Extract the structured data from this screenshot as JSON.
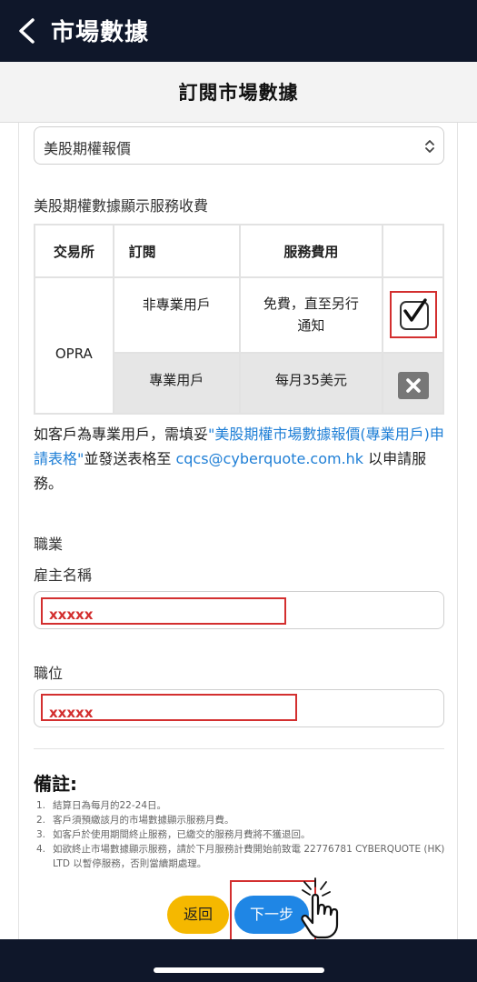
{
  "header": {
    "title": "市場數據"
  },
  "subheader": {
    "title": "訂閱市場數據"
  },
  "select": {
    "value": "美股期權報價"
  },
  "section": {
    "title": "美股期權數據顯示服務收費"
  },
  "table": {
    "headers": [
      "交易所",
      "訂閱",
      "服務費用",
      ""
    ],
    "exchange": "OPRA",
    "rows": [
      {
        "type": "非專業用戶",
        "fee": "免費，直至另行通知",
        "selected": true
      },
      {
        "type": "專業用戶",
        "fee": "每月35美元",
        "selected": false
      }
    ]
  },
  "notice": {
    "part1": "如客戶為專業用戶，需填妥",
    "link": "\"美股期權市場數據報價(專業用戶)申請表格\"",
    "part2": "並發送表格至 ",
    "email": "cqcs@cyberquote.com.hk",
    "part3": " 以申請服務。"
  },
  "form": {
    "occupation_label": "職業",
    "employer_label": "雇主名稱",
    "employer_value": "xxxxx",
    "position_label": "職位",
    "position_value": "xxxxx"
  },
  "remarks": {
    "title": "備註:",
    "items": [
      {
        "num": "1.",
        "text": "結算日為每月的22-24日。"
      },
      {
        "num": "2.",
        "text": "客戶須預繳該月的市場數據顯示服務月費。"
      },
      {
        "num": "3.",
        "text": "如客戶於使用期間終止服務，已繳交的服務月費將不獲退回。"
      },
      {
        "num": "4.",
        "text": "如欲終止市場數據顯示服務，請於下月服務計費開始前致電 22776781 CYBERQUOTE (HK) LTD 以暫停服務，否則當續期處理。"
      }
    ]
  },
  "buttons": {
    "back": "返回",
    "next": "下一步"
  },
  "colors": {
    "nav": "#0f172a",
    "link": "#1f7fd6",
    "back_button": "#f5b800",
    "next_button": "#1f86e5",
    "highlight": "#d32f2f"
  }
}
